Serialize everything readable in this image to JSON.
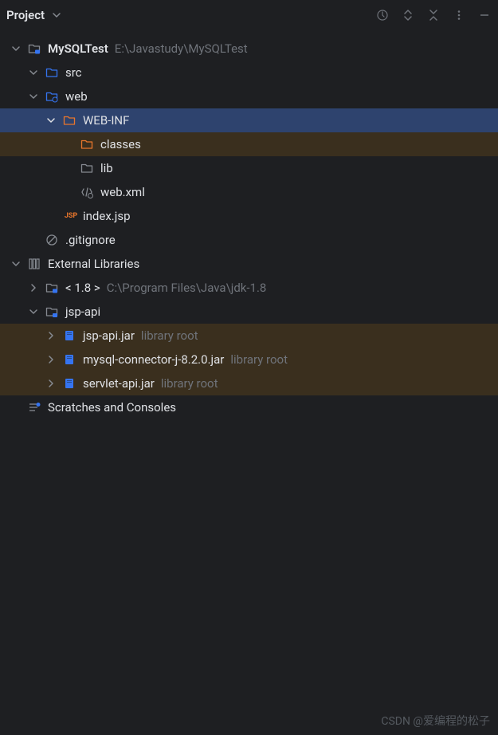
{
  "toolbar": {
    "title": "Project"
  },
  "tree": {
    "root": {
      "name": "MySQLTest",
      "path": "E:\\Javastudy\\MySQLTest"
    },
    "src": {
      "name": "src"
    },
    "web": {
      "name": "web"
    },
    "webinf": {
      "name": "WEB-INF"
    },
    "classes": {
      "name": "classes"
    },
    "lib": {
      "name": "lib"
    },
    "webxml": {
      "name": "web.xml"
    },
    "indexjsp": {
      "name": "index.jsp"
    },
    "gitignore": {
      "name": ".gitignore"
    },
    "extlib": {
      "name": "External Libraries"
    },
    "jdk": {
      "name": "< 1.8 >",
      "hint": "C:\\Program Files\\Java\\jdk-1.8"
    },
    "jspapi": {
      "name": "jsp-api"
    },
    "jspjar": {
      "name": "jsp-api.jar",
      "hint": "library root"
    },
    "mysqljar": {
      "name": "mysql-connector-j-8.2.0.jar",
      "hint": "library root"
    },
    "servletjar": {
      "name": "servlet-api.jar",
      "hint": "library root"
    },
    "scratches": {
      "name": "Scratches and Consoles"
    }
  },
  "watermark": "CSDN @爱编程的松子"
}
